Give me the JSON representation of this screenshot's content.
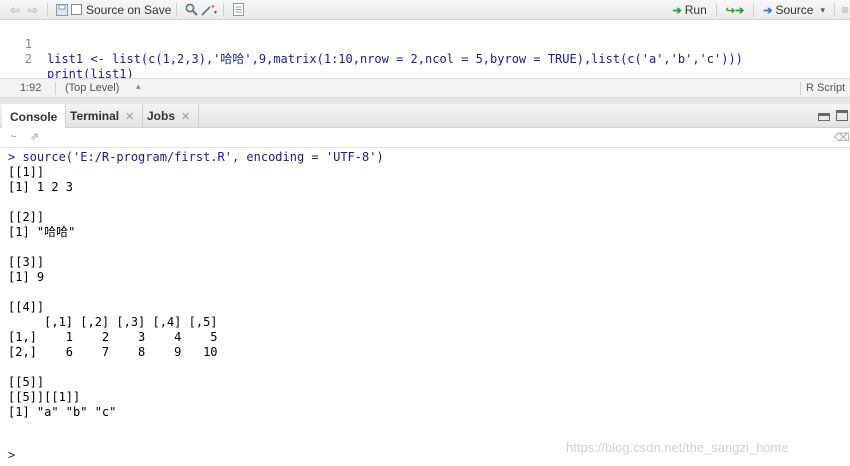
{
  "toolbar": {
    "source_on_save_label": "Source on Save",
    "run_label": "Run",
    "source_label": "Source"
  },
  "editor": {
    "lines": [
      {
        "number": "1",
        "code": "list1 <- list(c(1,2,3),'哈哈',9,matrix(1:10,nrow = 2,ncol = 5,byrow = TRUE),list(c('a','b','c')))"
      },
      {
        "number": "2",
        "code": "print(list1)"
      }
    ]
  },
  "statusbar": {
    "cursor_position": "1:92",
    "scope": "(Top Level)",
    "file_type": "R Script"
  },
  "console_tabs": [
    {
      "label": "Console"
    },
    {
      "label": "Terminal"
    },
    {
      "label": "Jobs"
    }
  ],
  "console": {
    "command": "> source('E:/R-program/first.R', encoding = 'UTF-8')",
    "output": [
      "[[1]]",
      "[1] 1 2 3",
      "",
      "[[2]]",
      "[1] \"哈哈\"",
      "",
      "[[3]]",
      "[1] 9",
      "",
      "[[4]]",
      "     [,1] [,2] [,3] [,4] [,5]",
      "[1,]    1    2    3    4    5",
      "[2,]    6    7    8    9   10",
      "",
      "[[5]]",
      "[[5]][[1]]",
      "[1] \"a\" \"b\" \"c\""
    ],
    "prompt": ">"
  },
  "watermark": "https://blog.csdn.net/the_sangzi_home",
  "colors": {
    "code_blue": "#1c1c8c",
    "string_green": "#0f7d0f",
    "run_green": "#2e9c3a"
  }
}
